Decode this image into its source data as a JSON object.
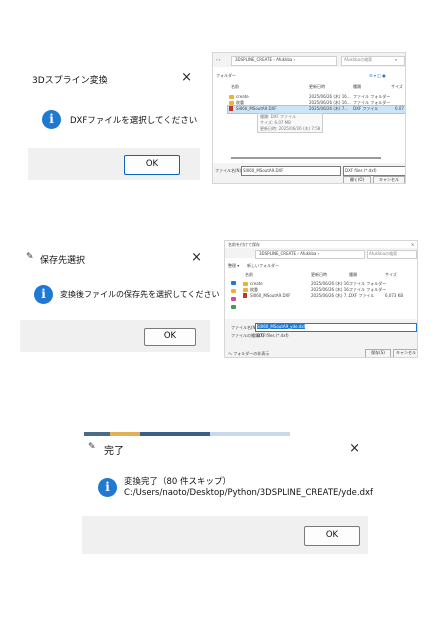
{
  "dialog1": {
    "title": "3Dスプライン変換",
    "close_glyph": "×",
    "icon": "info-icon",
    "message": "DXFファイルを選択してください",
    "ok_label": "OK"
  },
  "dialog2": {
    "title": "保存先選択",
    "close_glyph": "×",
    "icon": "info-icon",
    "message": "変換後ファイルの保存先を選択してください",
    "ok_label": "OK"
  },
  "dialog3": {
    "title": "完了",
    "close_glyph": "×",
    "icon": "info-icon",
    "message_line1": "変換完了（80 件スキップ）",
    "message_line2": "C:/Users/naoto/Desktop/Python/3DSPLINE_CREATE/yde.dxf",
    "ok_label": "OK"
  },
  "open_dialog": {
    "breadcrumb": "3DSPLINE_CREATE › Afukkba ›",
    "search_placeholder": "Afukkbaの検索",
    "toolbar_left": "フォルダー",
    "columns": [
      "名前",
      "更新日時",
      "種類",
      "サイズ"
    ],
    "rows": [
      {
        "name": "create",
        "date": "2025/06/26 (木) 16...",
        "type": "ファイル フォルダー",
        "size": ""
      },
      {
        "name": "枚重",
        "date": "2025/06/26 (木) 16...",
        "type": "ファイル フォルダー",
        "size": ""
      },
      {
        "name": "SI060_MSoutA9.DXF",
        "date": "2025/06/26 (木) 7...",
        "type": "DXF ファイル",
        "size": "6.07"
      }
    ],
    "tooltip": [
      "種類: DXF ファイル",
      "サイズ: 6.07 MB",
      "更新日時: 2025/06/26 (木) 7:58"
    ],
    "filename_label": "ファイル名(N):",
    "filename_value": "SI060_MSoutA9.DXF",
    "filter": "DXF files (*.dxf)",
    "open_label": "開く(O)",
    "cancel_label": "キャンセル"
  },
  "save_dialog": {
    "title": "名前を付けて保存",
    "breadcrumb": "3DSPLINE_CREATE › Afukkba ›",
    "search_placeholder": "Afukkbaの検索",
    "toolbar_left": "整理 ▾",
    "new_folder": "新しいフォルダー",
    "columns": [
      "名前",
      "更新日時",
      "種類",
      "サイズ"
    ],
    "rows": [
      {
        "name": "create",
        "date": "2025/06/26 (木) 16...",
        "type": "ファイル フォルダー",
        "size": ""
      },
      {
        "name": "枚重",
        "date": "2025/06/26 (木) 16...",
        "type": "ファイル フォルダー",
        "size": ""
      },
      {
        "name": "SI060_MSoutA9.DXF",
        "date": "2025/06/26 (木) 7...",
        "type": "DXF ファイル",
        "size": "6,073 KB"
      }
    ],
    "filename_label": "ファイル名(N):",
    "filename_value": "SI060_MSoutA9_yde.dxf",
    "type_label": "ファイルの種類(T):",
    "type_value": "DXF files (*.dxf)",
    "hide_folders": "へ フォルダーの非表示",
    "save_label": "保存(S)",
    "cancel_label": "キャンセル"
  },
  "colors": {
    "accent_blue": "#1f78d1",
    "footer_gray": "#f0f0f0",
    "selection": "#cce4f7"
  }
}
